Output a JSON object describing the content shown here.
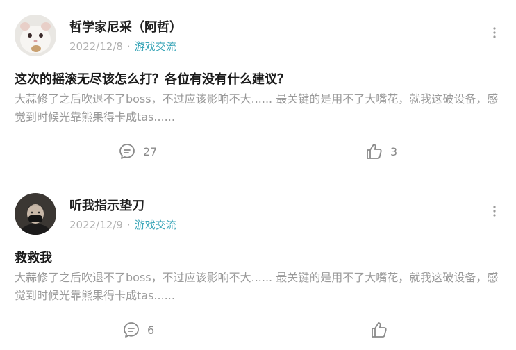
{
  "posts": [
    {
      "author": "哲学家尼采（阿哲）",
      "date": "2022/12/8",
      "separator": "·",
      "tag": "游戏交流",
      "title": "这次的摇滚无尽该怎么打？各位有没有什么建议？",
      "excerpt": "大蒜修了之后吹退不了boss，不过应该影响不大...... 最关键的是用不了大嘴花，就我这破设备，感觉到时候光靠熊果得卡成tas......",
      "comments": "27",
      "likes": "3",
      "avatar_icon": "hamster-avatar"
    },
    {
      "author": "听我指示垫刀",
      "date": "2022/12/9",
      "separator": "·",
      "tag": "游戏交流",
      "title": "救救我",
      "excerpt": "大蒜修了之后吹退不了boss，不过应该影响不大...... 最关键的是用不了大嘴花，就我这破设备，感觉到时候光靠熊果得卡成tas......",
      "comments": "6",
      "likes": "",
      "avatar_icon": "masked-person-avatar"
    }
  ],
  "colors": {
    "tag": "#3aa6b8",
    "meta": "#b0b0b0",
    "excerpt": "#9a9a9a",
    "action": "#8a8a8a"
  },
  "icons": [
    "more-vertical-icon",
    "comment-icon",
    "thumbs-up-icon"
  ]
}
